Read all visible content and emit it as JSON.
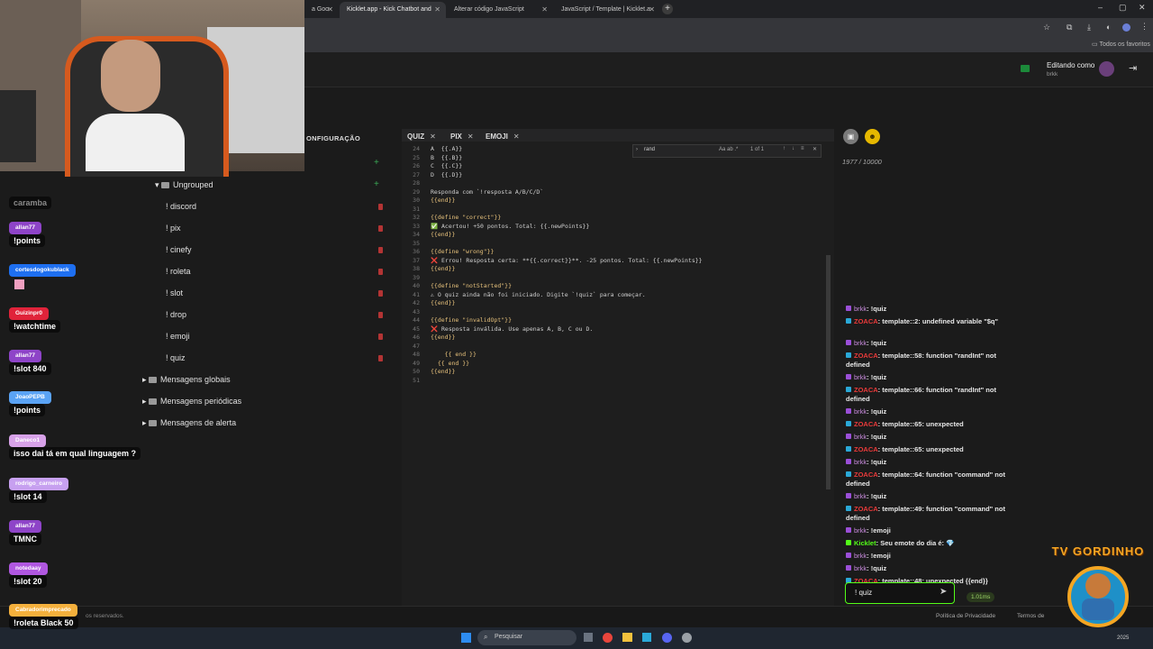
{
  "browser": {
    "tabs": [
      "a Goo",
      "Kicklet.app - Kick Chatbot and",
      "Alterar código JavaScript",
      "JavaScript / Template | Kicklet.a"
    ],
    "new_tab": "+",
    "bookmarks_label": "Todos os favoritos",
    "window_controls": [
      "–",
      "▢",
      "✕"
    ]
  },
  "header": {
    "editing_label": "Editando como",
    "editing_user": "brkk"
  },
  "sidebar": {
    "section_label": "ONFIGURAÇÃO",
    "group_label": "Ungrouped",
    "commands": [
      "! discord",
      "! pix",
      "! cinefy",
      "! roleta",
      "! slot",
      "! drop",
      "! emoji",
      "! quiz"
    ],
    "folders": [
      "Mensagens globais",
      "Mensagens periódicas",
      "Mensagens de alerta"
    ]
  },
  "editor": {
    "tabs": [
      "QUIZ",
      "PIX",
      "EMOJI"
    ],
    "find": {
      "query": "rand",
      "options": "Aa  ab  .*",
      "count": "1 of 1"
    },
    "lines": [
      {
        "n": "24",
        "text": "A  {{.A}}"
      },
      {
        "n": "25",
        "text": "B  {{.B}}"
      },
      {
        "n": "26",
        "text": "C  {{.C}}"
      },
      {
        "n": "27",
        "text": "D  {{.D}}"
      },
      {
        "n": "28",
        "text": ""
      },
      {
        "n": "29",
        "text": "Responda com `!resposta A/B/C/D`"
      },
      {
        "n": "30",
        "text": "{{end}}"
      },
      {
        "n": "31",
        "text": ""
      },
      {
        "n": "32",
        "text": "{{define \"correct\"}}"
      },
      {
        "n": "33",
        "text": "✅ Acertou! +50 pontos. Total: {{.newPoints}}"
      },
      {
        "n": "34",
        "text": "{{end}}"
      },
      {
        "n": "35",
        "text": ""
      },
      {
        "n": "36",
        "text": "{{define \"wrong\"}}"
      },
      {
        "n": "37",
        "text": "❌ Errou! Resposta certa: **{{.correct}}**. -25 pontos. Total: {{.newPoints}}"
      },
      {
        "n": "38",
        "text": "{{end}}"
      },
      {
        "n": "39",
        "text": ""
      },
      {
        "n": "40",
        "text": "{{define \"notStarted\"}}"
      },
      {
        "n": "41",
        "text": "⚠ O quiz ainda não foi iniciado. Digite `!quiz` para começar."
      },
      {
        "n": "42",
        "text": "{{end}}"
      },
      {
        "n": "43",
        "text": ""
      },
      {
        "n": "44",
        "text": "{{define \"invalidOpt\"}}"
      },
      {
        "n": "45",
        "text": "❌ Resposta inválida. Use apenas A, B, C ou D."
      },
      {
        "n": "46",
        "text": "{{end}}"
      },
      {
        "n": "47",
        "text": ""
      },
      {
        "n": "48",
        "text": "    {{ end }}"
      },
      {
        "n": "49",
        "text": "  {{ end }}"
      },
      {
        "n": "50",
        "text": "{{end}}"
      },
      {
        "n": "51",
        "text": ""
      }
    ]
  },
  "right_panel": {
    "char_count": "1977 / 10000"
  },
  "chat": {
    "messages": [
      {
        "user": "brkk",
        "text": "!quiz",
        "style": "brkk"
      },
      {
        "user": "ZOACA",
        "text": "template::2: undefined variable \"$q\"",
        "style": "red"
      },
      {
        "user": "brkk",
        "text": "!quiz",
        "style": "brkk"
      },
      {
        "user": "ZOACA",
        "text": "template::58: function \"randInt\" not defined",
        "style": "red"
      },
      {
        "user": "brkk",
        "text": "!quiz",
        "style": "brkk"
      },
      {
        "user": "ZOACA",
        "text": "template::66: function \"randInt\" not defined",
        "style": "red"
      },
      {
        "user": "brkk",
        "text": "!quiz",
        "style": "brkk"
      },
      {
        "user": "ZOACA",
        "text": "template::65: unexpected",
        "style": "red"
      },
      {
        "user": "brkk",
        "text": "!quiz",
        "style": "brkk"
      },
      {
        "user": "ZOACA",
        "text": "template::65: unexpected",
        "style": "red"
      },
      {
        "user": "brkk",
        "text": "!quiz",
        "style": "brkk"
      },
      {
        "user": "ZOACA",
        "text": "template::64: function \"command\" not defined",
        "style": "red"
      },
      {
        "user": "brkk",
        "text": "!quiz",
        "style": "brkk"
      },
      {
        "user": "ZOACA",
        "text": "template::49: function \"command\" not defined",
        "style": "red"
      },
      {
        "user": "brkk",
        "text": "!emoji",
        "style": "brkk"
      },
      {
        "user": "Kicklet",
        "text": "Seu emote do dia é: 💎",
        "style": "kick"
      },
      {
        "user": "brkk",
        "text": "!emoji",
        "style": "brkk"
      },
      {
        "user": "brkk",
        "text": "!quiz",
        "style": "brkk"
      },
      {
        "user": "ZOACA",
        "text": "template::48: unexpected {{end}}",
        "style": "red"
      }
    ],
    "input_value": "!  quiz",
    "latency": "1.01ms"
  },
  "footer": {
    "left": "os reservados.",
    "privacy": "Política de Privacidade",
    "terms": "Termos de"
  },
  "taskbar": {
    "search_label": "Pesquisar",
    "year": "2025"
  },
  "overlay": {
    "title": "TV GORDINHO",
    "chat": [
      {
        "name": "",
        "msg": "caramba",
        "color": "#6a6a6a"
      },
      {
        "name": "allan77",
        "msg": "!points",
        "color": "#8e44c8"
      },
      {
        "name": "cortesdogokublack",
        "msg": "",
        "color": "#1e6ff0"
      },
      {
        "name": "Guizinpr0",
        "msg": "!watchtime",
        "color": "#e0233a"
      },
      {
        "name": "allan77",
        "msg": "!slot 840",
        "color": "#8e44c8"
      },
      {
        "name": "JoaoPEPB",
        "msg": "!points",
        "color": "#5aa3f5"
      },
      {
        "name": "Daneco1",
        "msg": "isso dai tá em qual linguagem ?",
        "color": "#d7a1e8"
      },
      {
        "name": "rodrigo_carneiro",
        "msg": "!slot 14",
        "color": "#c7a0f0"
      },
      {
        "name": "allan77",
        "msg": "TMNC",
        "color": "#8e44c8"
      },
      {
        "name": "notedaay",
        "msg": "!slot 20",
        "color": "#b057e0"
      },
      {
        "name": "Cabradorimprecado",
        "msg": "!roleta Black 50",
        "color": "#f4b03c"
      }
    ]
  }
}
